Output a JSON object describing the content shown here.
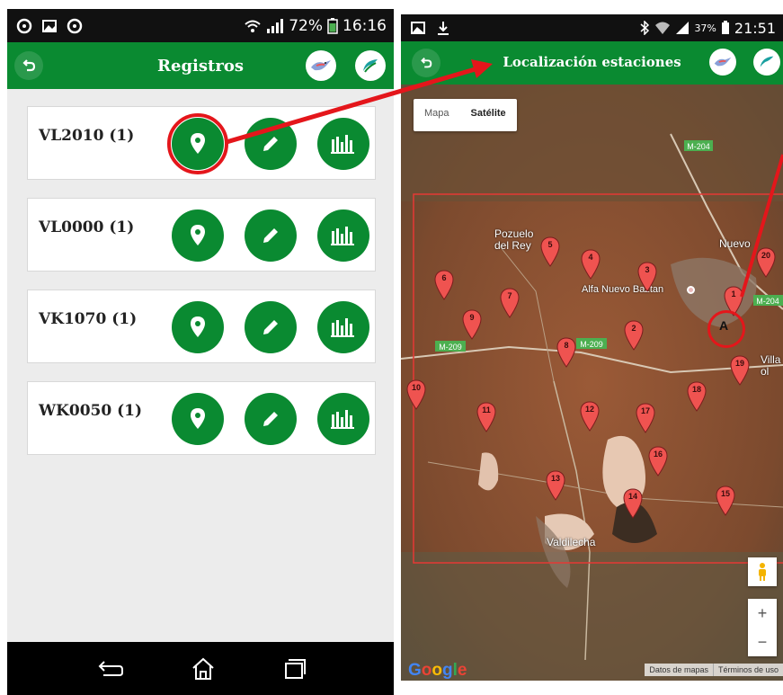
{
  "left_screen": {
    "status": {
      "battery": "72%",
      "time": "16:16"
    },
    "app_bar": {
      "title": "Registros"
    },
    "records": [
      {
        "label": "VL2010 (1)"
      },
      {
        "label": "VL0000 (1)"
      },
      {
        "label": "VK1070 (1)"
      },
      {
        "label": "WK0050 (1)"
      }
    ]
  },
  "right_screen": {
    "status": {
      "battery": "37%",
      "time": "21:51"
    },
    "app_bar": {
      "title": "Localización estaciones"
    },
    "map": {
      "map_types": [
        "Mapa",
        "Satélite"
      ],
      "active_map_type": "Satélite",
      "road_labels": [
        "M-204",
        "M-209",
        "M-209",
        "M-204"
      ],
      "place_labels": [
        "Pozuelo del Rey",
        "Nuevo Baztán",
        "Alfa Nuevo Baztan",
        "Valdilecha",
        "Villar del Olmo"
      ],
      "place_labels_shown": [
        "Pozuelo\ndel Rey",
        "Nuevo",
        "Alfa Nuevo Baztan",
        "Valdilecha",
        "Villa\nol"
      ],
      "station_markers": [
        "1",
        "2",
        "3",
        "4",
        "5",
        "6",
        "7",
        "8",
        "9",
        "10",
        "11",
        "12",
        "13",
        "14",
        "15",
        "16",
        "17",
        "18",
        "19",
        "20"
      ],
      "current_marker": "A",
      "zoom_in": "+",
      "zoom_out": "−",
      "logo": "Google",
      "footer_links": [
        "Datos de mapas",
        "Términos de uso"
      ]
    }
  },
  "colors": {
    "brand_green": "#0a8a31",
    "highlight_red": "#e4161b",
    "marker_red": "#ef5350"
  }
}
